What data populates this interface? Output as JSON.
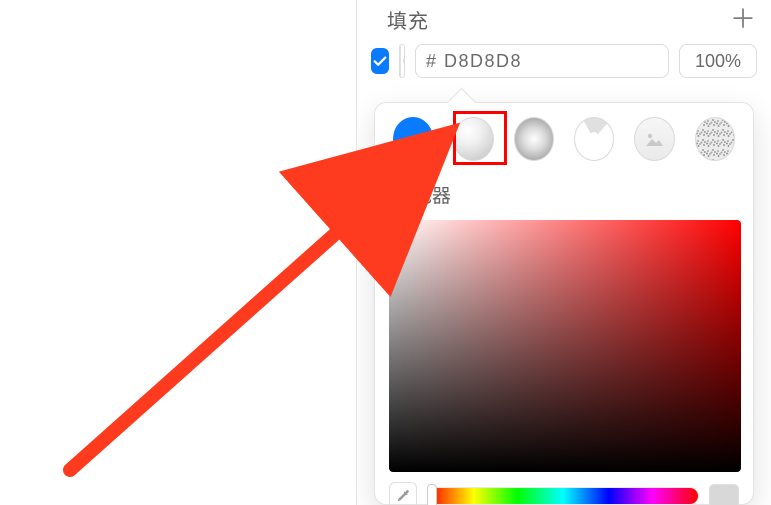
{
  "section": {
    "title": "填充"
  },
  "fill": {
    "enabled": true,
    "hex": "# D8D8D8",
    "opacity": "100%"
  },
  "popover": {
    "picker_label_fragment": "色器",
    "modes": {
      "solid": "solid-color",
      "linear": "linear-gradient",
      "radial": "radial-gradient",
      "angular": "angular-gradient",
      "image": "image-fill",
      "noise": "noise-fill"
    },
    "selected_mode": "linear",
    "hue": 0
  },
  "annotation": {
    "highlight_target": "linear-gradient"
  }
}
